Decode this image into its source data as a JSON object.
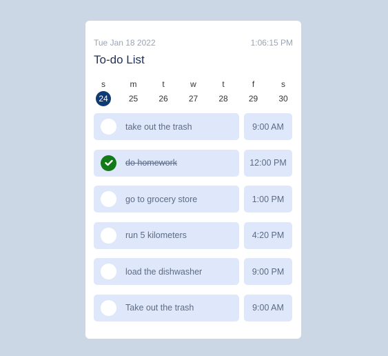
{
  "header": {
    "date": "Tue Jan 18 2022",
    "time": "1:06:15 PM",
    "title": "To-do List"
  },
  "week": [
    {
      "name": "s",
      "num": "24",
      "selected": true
    },
    {
      "name": "m",
      "num": "25",
      "selected": false
    },
    {
      "name": "t",
      "num": "26",
      "selected": false
    },
    {
      "name": "w",
      "num": "27",
      "selected": false
    },
    {
      "name": "t",
      "num": "28",
      "selected": false
    },
    {
      "name": "f",
      "num": "29",
      "selected": false
    },
    {
      "name": "s",
      "num": "30",
      "selected": false
    }
  ],
  "tasks": [
    {
      "label": "take out the trash",
      "time": "9:00 AM",
      "done": false
    },
    {
      "label": "do homework",
      "time": "12:00 PM",
      "done": true
    },
    {
      "label": "go to grocery store",
      "time": "1:00 PM",
      "done": false
    },
    {
      "label": "run 5 kilometers",
      "time": "4:20 PM",
      "done": false
    },
    {
      "label": "load the dishwasher",
      "time": "9:00 PM",
      "done": false
    },
    {
      "label": "Take out the trash",
      "time": "9:00 AM",
      "done": false
    }
  ],
  "colors": {
    "accent": "#103a73",
    "done": "#127a18",
    "item_bg": "#dfe8fb"
  }
}
